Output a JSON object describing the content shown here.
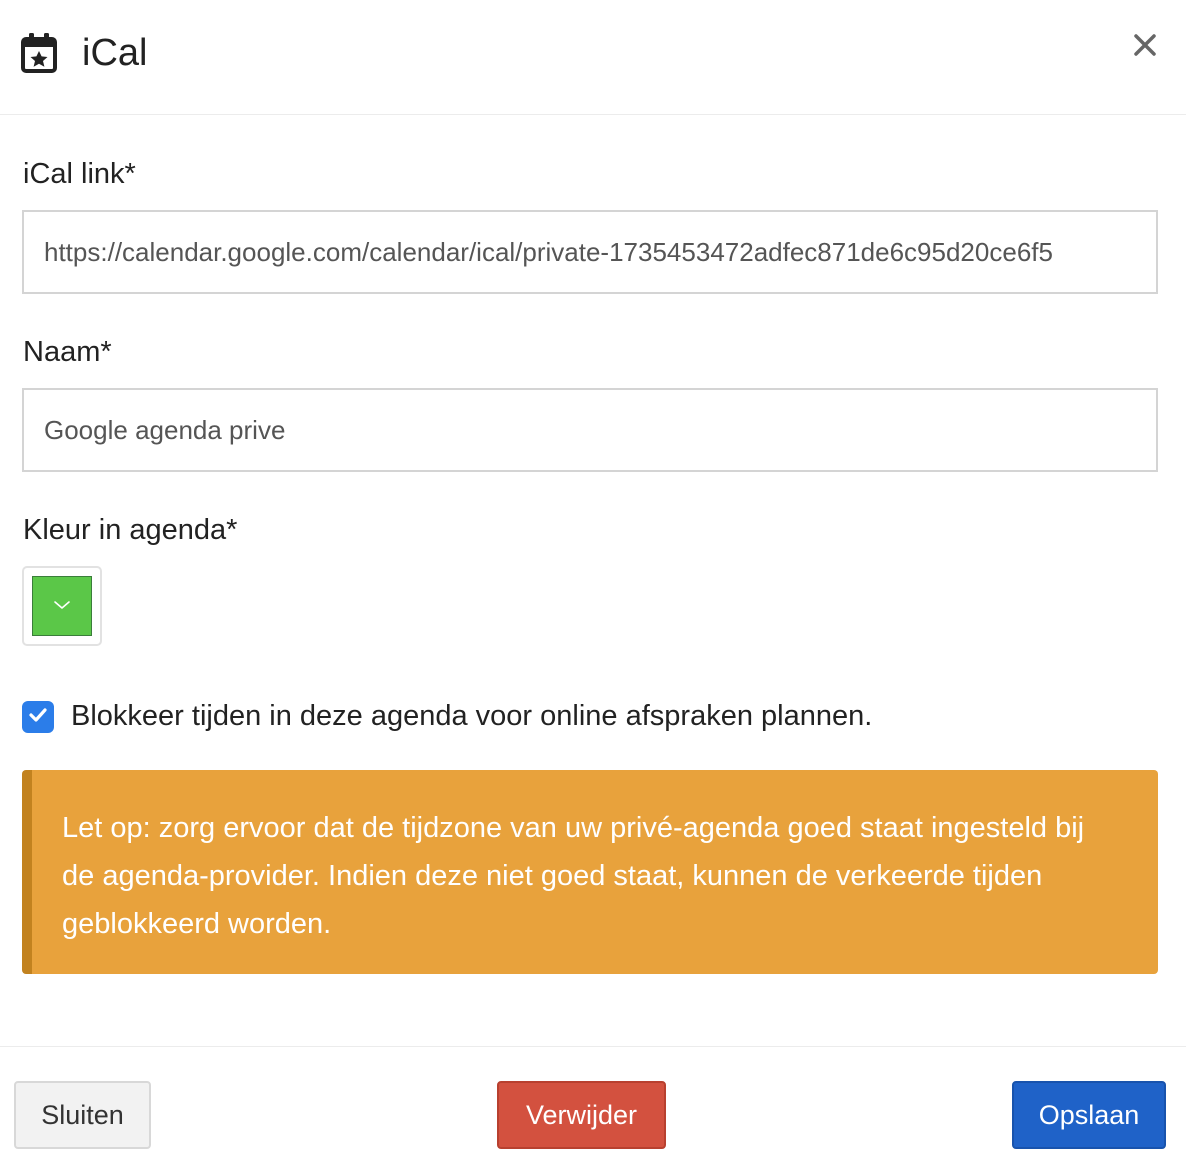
{
  "header": {
    "title": "iCal",
    "icon": "calendar-star-icon",
    "close_icon": "close-icon"
  },
  "form": {
    "ical_link": {
      "label": "iCal link*",
      "value": "https://calendar.google.com/calendar/ical/private-1735453472adfec871de6c95d20ce6f5"
    },
    "name": {
      "label": "Naam*",
      "value": "Google agenda prive"
    },
    "color": {
      "label": "Kleur in agenda*",
      "value": "#5bc748"
    },
    "block_times": {
      "label": "Blokkeer tijden in deze agenda voor online afspraken plannen.",
      "checked": true
    }
  },
  "alert": {
    "text": "Let op: zorg ervoor dat de tijdzone van uw privé-agenda goed staat ingesteld bij de agenda-provider. Indien deze niet goed staat, kunnen de verkeerde tijden geblokkeerd worden."
  },
  "footer": {
    "close_label": "Sluiten",
    "delete_label": "Verwijder",
    "save_label": "Opslaan"
  },
  "colors": {
    "primary": "#1f62c8",
    "danger": "#d3513f",
    "warning": "#e8a23c",
    "checkbox": "#2b7de9"
  }
}
